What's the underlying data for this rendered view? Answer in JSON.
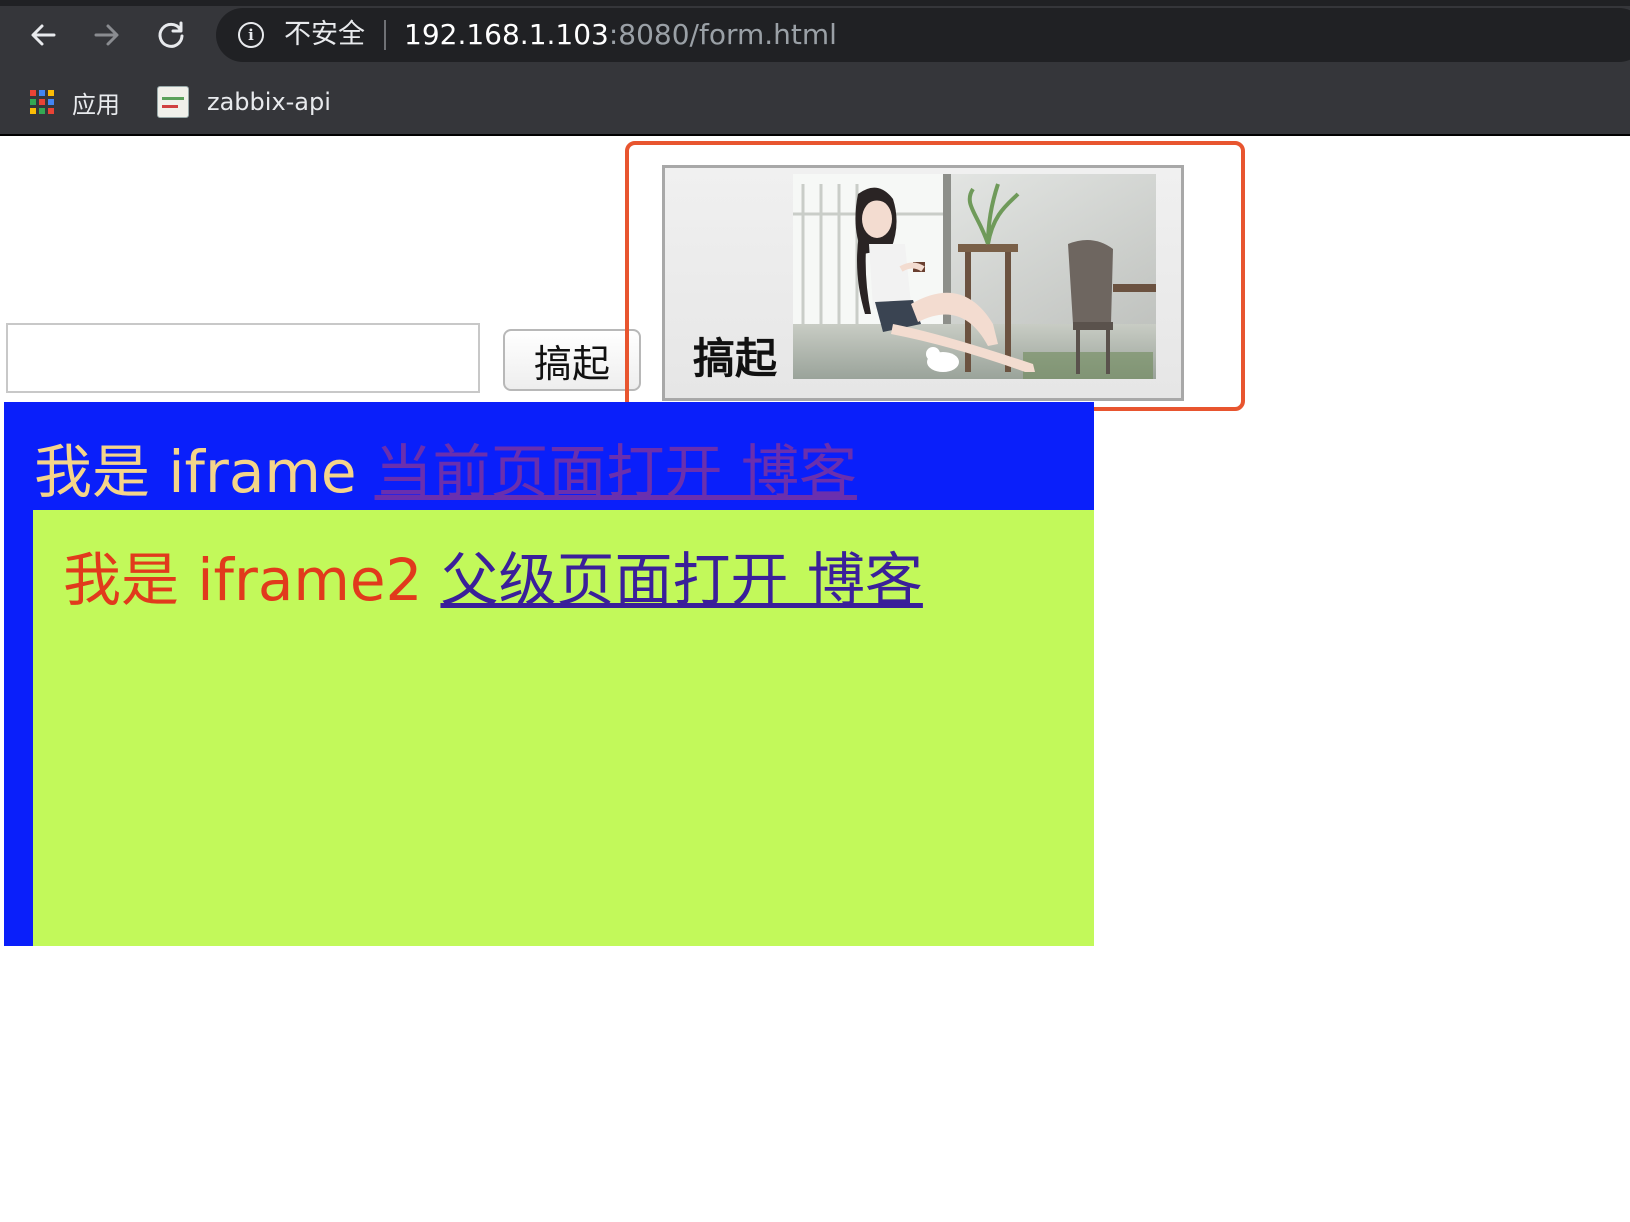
{
  "browser": {
    "security_label": "不安全",
    "url_host": "192.168.1.103",
    "url_rest": ":8080/form.html",
    "bookmarks": [
      {
        "label": "应用",
        "icon": "apps-grid-icon"
      },
      {
        "label": "zabbix-api",
        "icon": "zabbix-favicon-icon"
      }
    ]
  },
  "form": {
    "input_value": "",
    "text_button_label": "搞起",
    "image_button_label": "搞起"
  },
  "iframe1": {
    "label": "我是 iframe",
    "link": "当前页面打开 博客",
    "bg_color": "#0a1ffa",
    "label_color": "#f4d48a"
  },
  "iframe2": {
    "label": "我是 iframe2",
    "link": "父级页面打开 博客",
    "bg_color": "#c2f95a",
    "label_color": "#e13a1c"
  },
  "highlight_color": "#e8552f"
}
